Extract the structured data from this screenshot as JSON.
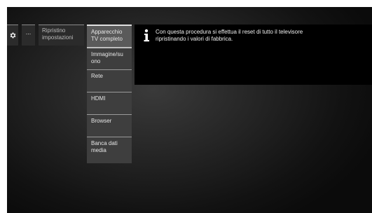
{
  "top_bar": {
    "gear_icon": "gear-icon",
    "more_label": "...",
    "breadcrumb_label": "Ripristino impostazioni"
  },
  "submenu": {
    "items": [
      {
        "label": "Apparecchio TV completo",
        "selected": true
      },
      {
        "label": "Immagine/suono"
      },
      {
        "label": "Rete"
      },
      {
        "label": "HDMI"
      },
      {
        "label": "Browser"
      },
      {
        "label": "Banca dati media"
      }
    ]
  },
  "info": {
    "icon": "info-icon",
    "text": "Con questa procedura si effettua il reset di tutto il televisore ripristinando i valori di fabbrica."
  }
}
